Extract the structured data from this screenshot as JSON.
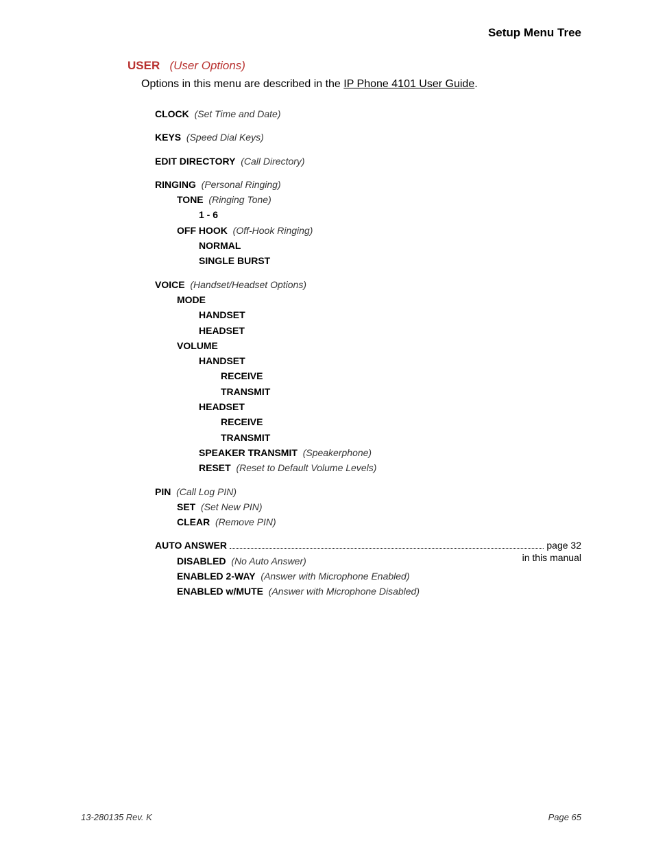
{
  "header": "Setup Menu Tree",
  "section": {
    "title": "USER",
    "desc": "(User Options)"
  },
  "intro": {
    "prefix": "Options in this menu are described in the ",
    "link": "IP Phone 4101 User Guide",
    "suffix": "."
  },
  "tree": {
    "clock": {
      "label": "CLOCK",
      "desc": "(Set Time and Date)"
    },
    "keys": {
      "label": "KEYS",
      "desc": "(Speed Dial Keys)"
    },
    "editdir": {
      "label": "EDIT DIRECTORY",
      "desc": "(Call Directory)"
    },
    "ringing": {
      "label": "RINGING",
      "desc": "(Personal Ringing)",
      "tone": {
        "label": "TONE",
        "desc": "(Ringing Tone)",
        "range": "1 - 6"
      },
      "offhook": {
        "label": "OFF HOOK",
        "desc": "(Off-Hook Ringing)",
        "normal": "NORMAL",
        "single": "SINGLE BURST"
      }
    },
    "voice": {
      "label": "VOICE",
      "desc": "(Handset/Headset Options)",
      "mode": {
        "label": "MODE",
        "handset": "HANDSET",
        "headset": "HEADSET"
      },
      "volume": {
        "label": "VOLUME",
        "handset": {
          "label": "HANDSET",
          "receive": "RECEIVE",
          "transmit": "TRANSMIT"
        },
        "headset": {
          "label": "HEADSET",
          "receive": "RECEIVE",
          "transmit": "TRANSMIT"
        },
        "speaker": {
          "label": "SPEAKER TRANSMIT",
          "desc": "(Speakerphone)"
        },
        "reset": {
          "label": "RESET",
          "desc": "(Reset to Default Volume Levels)"
        }
      }
    },
    "pin": {
      "label": "PIN",
      "desc": "(Call Log PIN)",
      "set": {
        "label": "SET",
        "desc": "(Set New PIN)"
      },
      "clear": {
        "label": "CLEAR",
        "desc": "(Remove PIN)"
      }
    },
    "auto": {
      "label": "AUTO ANSWER",
      "pageref": "page 32",
      "inmanual": "in this manual",
      "disabled": {
        "label": "DISABLED",
        "desc": "(No Auto Answer)"
      },
      "enabled2": {
        "label": "ENABLED 2-WAY",
        "desc": "(Answer with Microphone Enabled)"
      },
      "enabledm": {
        "label": "ENABLED w/MUTE",
        "desc": "(Answer with Microphone Disabled)"
      }
    }
  },
  "footer": {
    "left": "13-280135  Rev. K",
    "right": "Page 65"
  }
}
